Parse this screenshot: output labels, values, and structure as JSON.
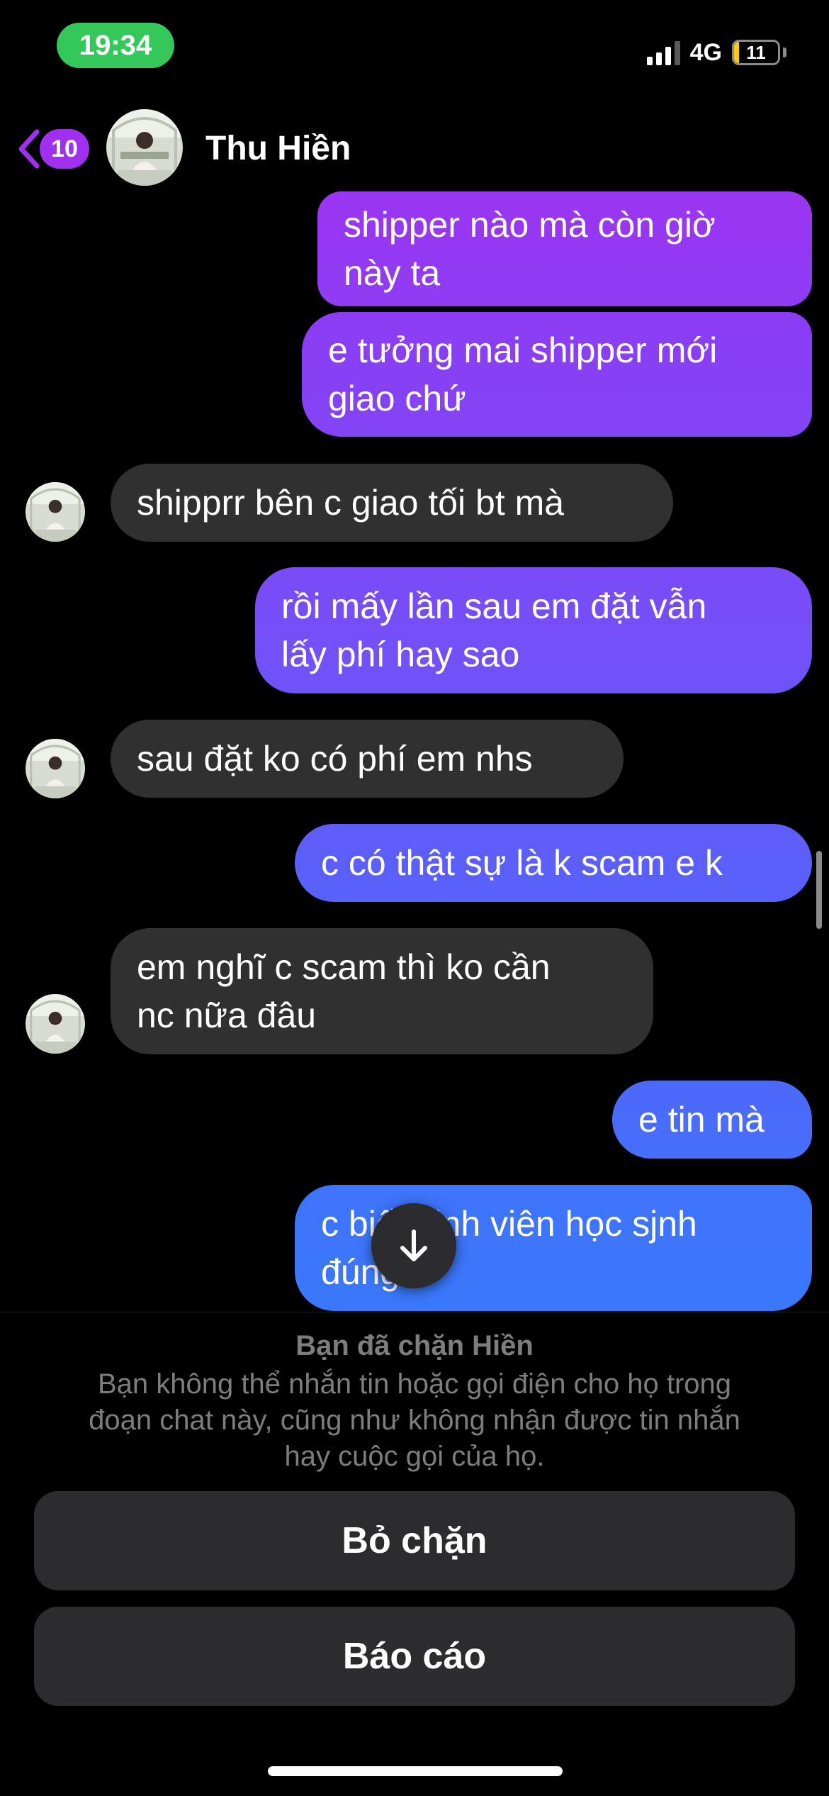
{
  "status_bar": {
    "time": "19:34",
    "network": "4G",
    "battery": 11,
    "battery_label": "11",
    "time_pill_color": "#34c759"
  },
  "header": {
    "back_badge": "10",
    "contact_name": "Thu Hiền",
    "accent_color": "#a02ff0"
  },
  "messages": [
    {
      "direction": "outgoing",
      "lines": [
        "shipper nào mà còn giờ",
        "này ta"
      ]
    },
    {
      "direction": "outgoing",
      "lines": [
        "e tưởng mai shipper mới",
        "giao chứ"
      ]
    },
    {
      "direction": "incoming",
      "lines": [
        "shipprr bên c giao tối bt mà"
      ]
    },
    {
      "direction": "outgoing",
      "lines": [
        "rồi mấy lần sau em đặt vẫn",
        "lấy phí hay sao"
      ]
    },
    {
      "direction": "incoming",
      "lines": [
        "sau đặt ko có phí em nhs"
      ]
    },
    {
      "direction": "outgoing",
      "lines": [
        "c có thật sự là k scam e k"
      ]
    },
    {
      "direction": "incoming",
      "lines": [
        "em nghĩ c scam thì ko cần",
        "nc nữa đâu"
      ]
    },
    {
      "direction": "outgoing",
      "lines": [
        "e tin mà"
      ]
    },
    {
      "direction": "outgoing",
      "lines": [
        "c biết sinh viên học sjnh",
        "đúng k"
      ]
    }
  ],
  "blocked": {
    "title": "Bạn đã chặn Hiền",
    "description_lines": [
      "Bạn không thể nhắn tin hoặc gọi điện cho họ trong",
      "đoạn chat này, cũng như không nhận được tin nhắn",
      "hay cuộc gọi của họ."
    ],
    "unblock_label": "Bỏ chặn",
    "report_label": "Báo cáo"
  },
  "icons": {
    "back": "chevron-left-icon",
    "scroll_down": "arrow-down-icon"
  }
}
